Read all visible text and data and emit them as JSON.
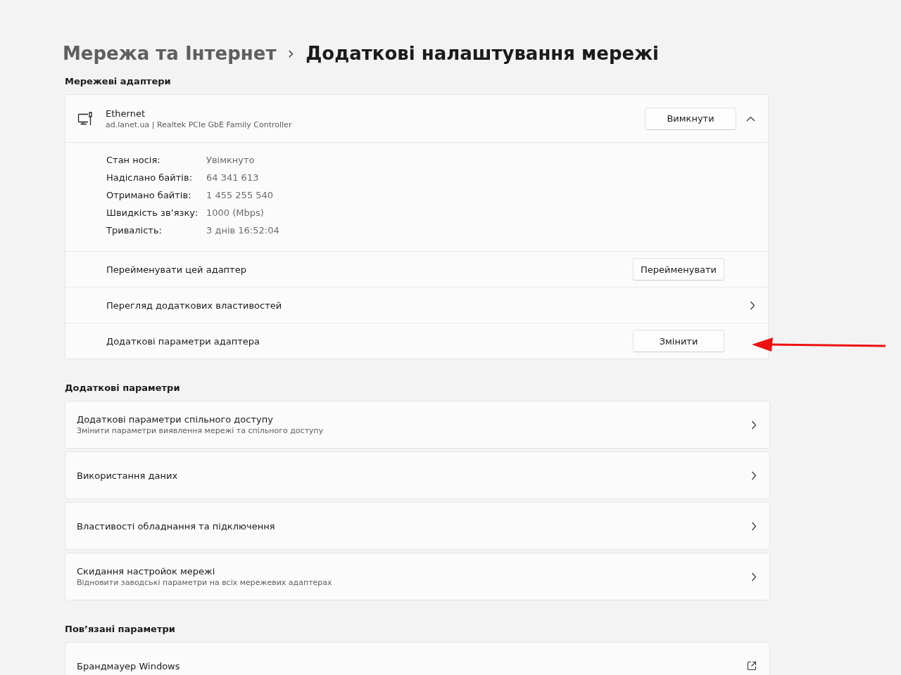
{
  "breadcrumb": {
    "parent": "Мережа та Інтернет",
    "separator": "›",
    "current": "Додаткові налаштування мережі"
  },
  "adapters_section": {
    "heading": "Мережеві адаптери",
    "adapter": {
      "name": "Ethernet",
      "description": "ad.lanet.ua | Realtek PCIe GbE Family Controller",
      "button": "Вимкнути",
      "expanded": true,
      "details": [
        {
          "label": "Стан носія:",
          "value": "Увімкнуто"
        },
        {
          "label": "Надіслано байтів:",
          "value": "64 341 613"
        },
        {
          "label": "Отримано байтів:",
          "value": "1 455 255 540"
        },
        {
          "label": "Швидкість зв’язку:",
          "value": "1000 (Mbps)"
        },
        {
          "label": "Тривалість:",
          "value": "3 днів 16:52:04"
        }
      ],
      "rows": [
        {
          "label": "Перейменувати цей адаптер",
          "kind": "button",
          "button": "Перейменувати"
        },
        {
          "label": "Перегляд додаткових властивостей",
          "kind": "link"
        },
        {
          "label": "Додаткові параметри адаптера",
          "kind": "button",
          "button": "Змінити"
        }
      ]
    }
  },
  "more_section": {
    "heading": "Додаткові параметри",
    "items": [
      {
        "title": "Додаткові параметри спільного доступу",
        "subtitle": "Змінити параметри виявлення мережі та спільного доступу",
        "kind": "link"
      },
      {
        "title": "Використання даних",
        "kind": "link"
      },
      {
        "title": "Властивості обладнання та підключення",
        "kind": "link"
      },
      {
        "title": "Скидання настройок мережі",
        "subtitle": "Відновити заводські параметри на всіх мережевих адаптерах",
        "kind": "link"
      }
    ]
  },
  "related_section": {
    "heading": "Пов’язані параметри",
    "items": [
      {
        "title": "Брандмауер Windows",
        "kind": "external"
      }
    ]
  }
}
